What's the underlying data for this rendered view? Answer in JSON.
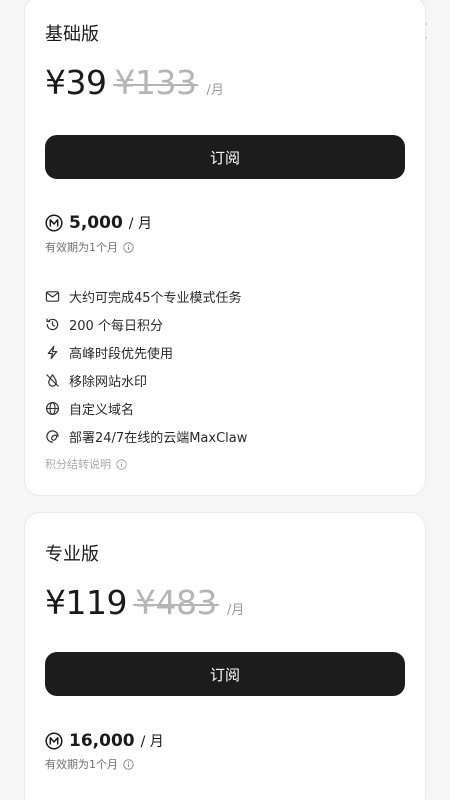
{
  "plans": [
    {
      "name": "基础版",
      "price": "¥39",
      "original_price": "¥133",
      "period": "/月",
      "subscribe_label": "订阅",
      "credits": "5,000",
      "credits_unit": "/ 月",
      "validity": "有效期为1个月",
      "features": [
        {
          "icon": "mail-icon",
          "text": "大约可完成45个专业模式任务"
        },
        {
          "icon": "history-icon",
          "text": "200 个每日积分"
        },
        {
          "icon": "lightning-icon",
          "text": "高峰时段优先使用"
        },
        {
          "icon": "no-watermark-icon",
          "text": "移除网站水印"
        },
        {
          "icon": "globe-icon",
          "text": "自定义域名"
        },
        {
          "icon": "cloud-deploy-icon",
          "text": "部署24/7在线的云端MaxClaw"
        }
      ],
      "rules_label": "积分结转说明"
    },
    {
      "name": "专业版",
      "price": "¥119",
      "original_price": "¥483",
      "period": "/月",
      "subscribe_label": "订阅",
      "credits": "16,000",
      "credits_unit": "/ 月",
      "validity": "有效期为1个月"
    }
  ],
  "colors": {
    "button_bg": "#1c1c1c",
    "strike_price": "#b5b5b5",
    "card_bg": "#ffffff"
  }
}
